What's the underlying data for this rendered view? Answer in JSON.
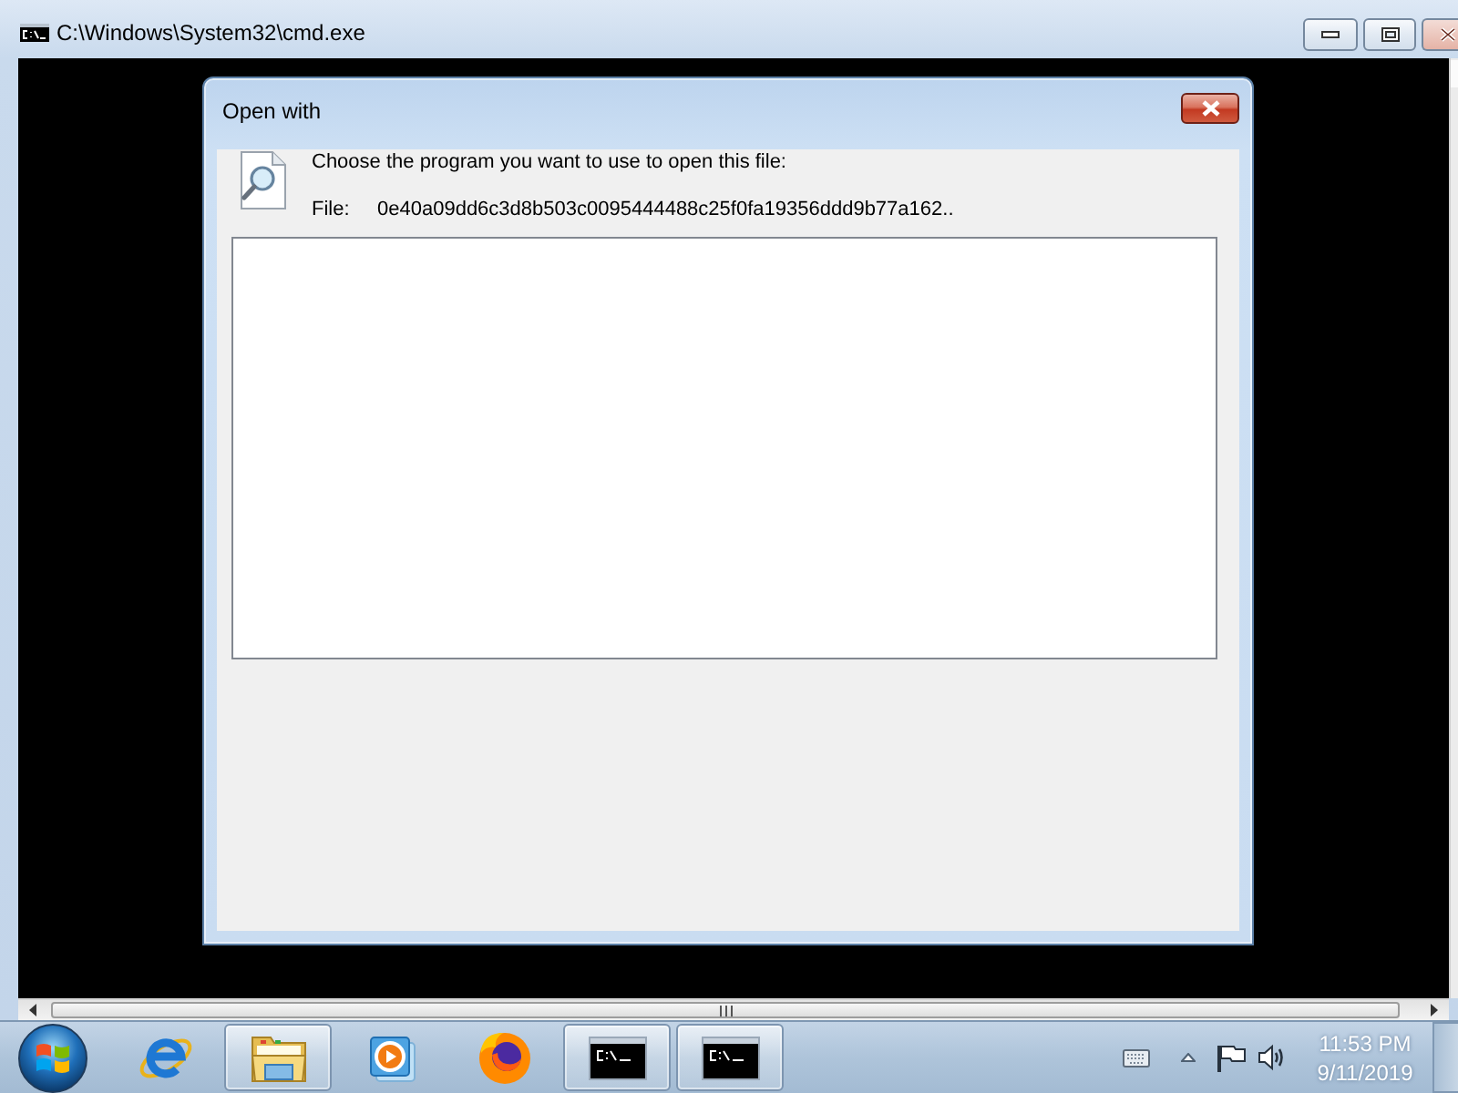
{
  "console_window": {
    "title": "C:\\Windows\\System32\\cmd.exe"
  },
  "dialog": {
    "title": "Open with",
    "prompt": "Choose the program you want to use to open this file:",
    "file_label": "File:",
    "file_name": "0e40a09dd6c3d8b503c0095444488c25f0fa19356ddd9b77a162.."
  },
  "taskbar": {
    "items": [
      {
        "kind": "ebrowser",
        "running": false
      },
      {
        "kind": "folders",
        "running": true
      },
      {
        "kind": "player",
        "running": false
      },
      {
        "kind": "foxbrowser",
        "running": false
      },
      {
        "kind": "console",
        "running": true
      },
      {
        "kind": "console",
        "running": true
      }
    ]
  },
  "clock": {
    "time": "11:53 PM",
    "date": "9/11/2019"
  }
}
